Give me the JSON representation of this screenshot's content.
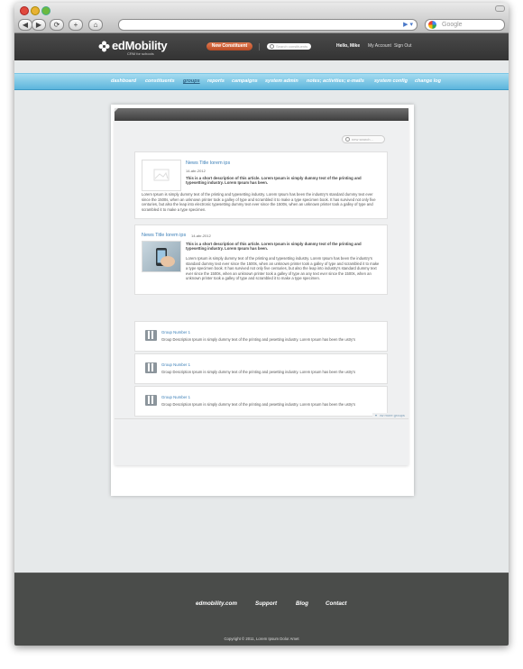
{
  "browser": {
    "back_icon": "◀",
    "forward_icon": "▶",
    "reload_icon": "⟳",
    "home_icon": "⌂",
    "search_placeholder": "Google"
  },
  "header": {
    "logo_name": "edMobility",
    "logo_tagline": "CRM for schools",
    "new_constituent_label": "New Constituent",
    "search_placeholder": "Search constituents",
    "greeting": "Hello, Mike",
    "my_account_label": "My Account",
    "sign_out_label": "Sign Out"
  },
  "nav": {
    "items": [
      {
        "label": "dashboard"
      },
      {
        "label": "constituents"
      },
      {
        "label": "groups"
      },
      {
        "label": "reports"
      },
      {
        "label": "campaigns"
      },
      {
        "label": "system admin"
      },
      {
        "label": "notes; activities; e-mails"
      },
      {
        "label": "system config"
      },
      {
        "label": "change log"
      }
    ],
    "active": "groups"
  },
  "content": {
    "search_placeholder": "new search...",
    "news": [
      {
        "title": "News Title lorem ips",
        "date": "14-abr-2012",
        "short": "This is a short description of this article. Lorem Ipsum is simply dummy text of the printing and typesetting industry. Lorem Ipsum has been.",
        "body": "Lorem Ipsum is simply dummy text of the printing and typesetting industry. Lorem Ipsum has been  the industry's standard dummy text ever since the 1500s, when an unknown printer took a galley of type and scrambled it to make a type specimen book. It has survived not only five centuries, but also the leap into electronic typesetting dummy text ever since the 1500s, when an unknown printer took a galley of type and scrambled it to make a type specimen."
      },
      {
        "title": "News Title lorem ips",
        "date": "14-abr-2012",
        "short": "This is a short description of this article. Lorem Ipsum is simply dummy text of the printing and typesetting industry. Lorem Ipsum has been.",
        "body": "Lorem Ipsum is simply dummy text of the printing and typesetting industry. Lorem Ipsum has been  the industry's standard dummy text ever since the 1500s, when an unknown printer took a galley of type and scrambled it to make a type specimen book. It has survived not only five centuries, but also the leap into industry's standard dummy text ever since the 1500s, when an unknown printer took a galley of type an any text ever since the 1500s, when an unknown printer took a galley of type and scrambled it to make a type specimen."
      }
    ],
    "groups": [
      {
        "name": "Group Number 1",
        "description": "Group Description Ipsum is simply dummy text of the printing and pesetting industry. Lorem Ipsum has been the ustry's"
      },
      {
        "name": "Group Number 1",
        "description": "Group Description Ipsum is simply dummy text of the printing and pesetting industry. Lorem Ipsum has been the ustry's"
      },
      {
        "name": "Group Number 1",
        "description": "Group Description Ipsum is simply dummy text of the printing and pesetting industry. Lorem Ipsum has been the ustry's"
      }
    ],
    "show_more_label": "show more groups"
  },
  "footer": {
    "links": [
      {
        "label": "edmobility.com"
      },
      {
        "label": "Support"
      },
      {
        "label": "Blog"
      },
      {
        "label": "Contact"
      }
    ],
    "copyright": "Copyright © 2011, Lorem Ipsum Dolor Amet"
  },
  "colors": {
    "accent_orange": "#c95c35",
    "nav_blue": "#6bbde0",
    "link_blue": "#3a7eb7",
    "header_dark": "#3c3c3c",
    "footer_dark": "#4a4c4a"
  }
}
